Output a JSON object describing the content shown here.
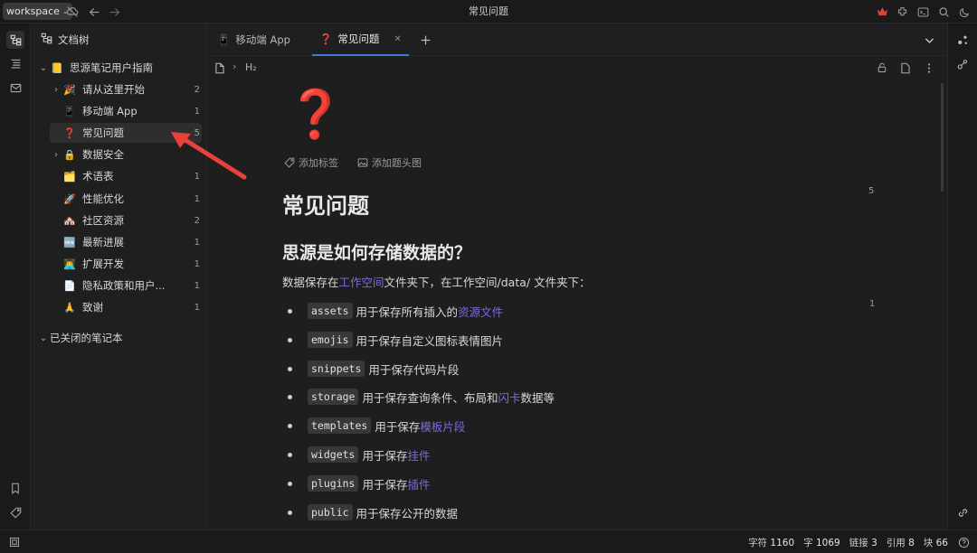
{
  "topbar": {
    "workspace": "workspace",
    "title": "常见问题"
  },
  "tree": {
    "header": "文档树",
    "notebook": {
      "icon": "📒",
      "label": "思源笔记用户指南"
    },
    "items": [
      {
        "arrow": "›",
        "icon": "🎉",
        "label": "请从这里开始",
        "count": "2"
      },
      {
        "arrow": "",
        "icon": "📱",
        "label": "移动端 App",
        "count": "1"
      },
      {
        "arrow": "",
        "icon": "❓",
        "label": "常见问题",
        "count": "5"
      },
      {
        "arrow": "›",
        "icon": "🔒",
        "label": "数据安全",
        "count": ""
      },
      {
        "arrow": "",
        "icon": "🗂️",
        "label": "术语表",
        "count": "1"
      },
      {
        "arrow": "",
        "icon": "🚀",
        "label": "性能优化",
        "count": "1"
      },
      {
        "arrow": "",
        "icon": "🏘️",
        "label": "社区资源",
        "count": "2"
      },
      {
        "arrow": "",
        "icon": "🆕",
        "label": "最新进展",
        "count": "1"
      },
      {
        "arrow": "",
        "icon": "👨‍💻",
        "label": "扩展开发",
        "count": "1"
      },
      {
        "arrow": "",
        "icon": "📄",
        "label": "隐私政策和用户...",
        "count": "1"
      },
      {
        "arrow": "",
        "icon": "🙏",
        "label": "致谢",
        "count": "1"
      }
    ],
    "closed_notebooks": "已关闭的笔记本"
  },
  "tabs": [
    {
      "icon": "📱",
      "label": "移动端 App",
      "active": false
    },
    {
      "icon": "❓",
      "label": "常见问题",
      "active": true
    }
  ],
  "breadcrumb": {
    "heading": "H₂"
  },
  "doc": {
    "icon": "❓",
    "add_tag": "添加标签",
    "add_cover": "添加题头图",
    "title": "常见问题",
    "title_refcount": "5",
    "h2": "思源是如何存储数据的？",
    "para_prefix": "数据保存在",
    "para_link": "工作空间",
    "para_suffix": "文件夹下，在工作空间/data/ 文件夹下：",
    "para_refcount": "1",
    "list": [
      {
        "code": "assets",
        "text": "用于保存所有插入的",
        "link": "资源文件",
        "tail": ""
      },
      {
        "code": "emojis",
        "text": "用于保存自定义图标表情图片",
        "link": "",
        "tail": ""
      },
      {
        "code": "snippets",
        "text": "用于保存代码片段",
        "link": "",
        "tail": ""
      },
      {
        "code": "storage",
        "text": "用于保存查询条件、布局和",
        "link": "闪卡",
        "tail": "数据等"
      },
      {
        "code": "templates",
        "text": "用于保存",
        "link": "模板片段",
        "tail": ""
      },
      {
        "code": "widgets",
        "text": "用于保存",
        "link": "挂件",
        "tail": ""
      },
      {
        "code": "plugins",
        "text": "用于保存",
        "link": "插件",
        "tail": ""
      },
      {
        "code": "public",
        "text": "用于保存公开的数据",
        "link": "",
        "tail": ""
      }
    ]
  },
  "status": {
    "chars_label": "字符",
    "chars": "1160",
    "words_label": "字",
    "words": "1069",
    "links_label": "链接",
    "links": "3",
    "refs_label": "引用",
    "refs": "8",
    "blocks_label": "块",
    "blocks": "66"
  },
  "colors": {
    "accent": "#3d7bd8",
    "link": "#7b6ae0",
    "annotation": "#e8403a"
  }
}
